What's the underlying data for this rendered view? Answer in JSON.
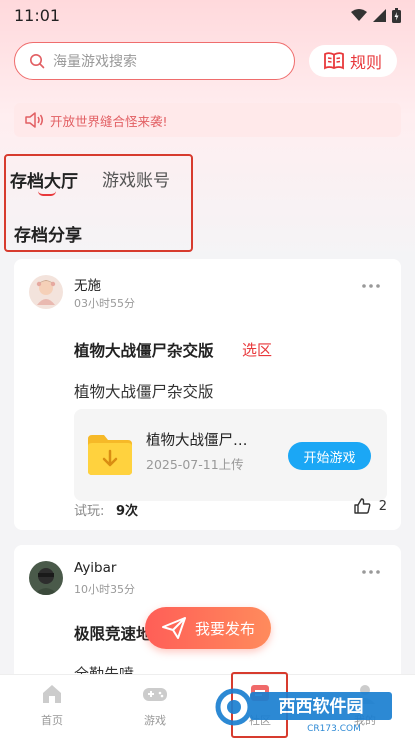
{
  "status_bar": {
    "time": "11:01"
  },
  "search": {
    "placeholder": "海量游戏搜索"
  },
  "rules_button": {
    "label": "规则"
  },
  "notice": {
    "text": "开放世界缝合怪来袭!"
  },
  "tabs": [
    {
      "label": "存档大厅",
      "active": true
    },
    {
      "label": "游戏账号",
      "active": false
    }
  ],
  "sub_tab": {
    "label": "存档分享"
  },
  "posts": [
    {
      "username": "无施",
      "time": "03小时55分",
      "game_title": "植物大战僵尸杂交版",
      "server_tag": "选区",
      "description": "植物大战僵尸杂交版",
      "file": {
        "name": "植物大战僵尸…",
        "date": "2025-07-11上传",
        "action": "开始游戏"
      },
      "try_label": "试玩:",
      "try_count": "9次",
      "likes": "2"
    },
    {
      "username": "Ayibar",
      "time": "10小时35分",
      "game_title": "极限竞速地",
      "description": "全勤先喷……"
    }
  ],
  "publish_button": {
    "label": "我要发布"
  },
  "bottom_nav": [
    {
      "label": "首页",
      "icon": "home-icon"
    },
    {
      "label": "游戏",
      "icon": "gamepad-icon"
    },
    {
      "label": "社区",
      "icon": "community-icon"
    },
    {
      "label": "我的",
      "icon": "profile-icon"
    }
  ],
  "watermark": {
    "text": "西西软件园",
    "url_text": "CR173.COM"
  },
  "colors": {
    "accent": "#e8383b",
    "start_button": "#1ba7f5",
    "publish_gradient_start": "#ff5e57",
    "publish_gradient_end": "#ff8b5c"
  }
}
